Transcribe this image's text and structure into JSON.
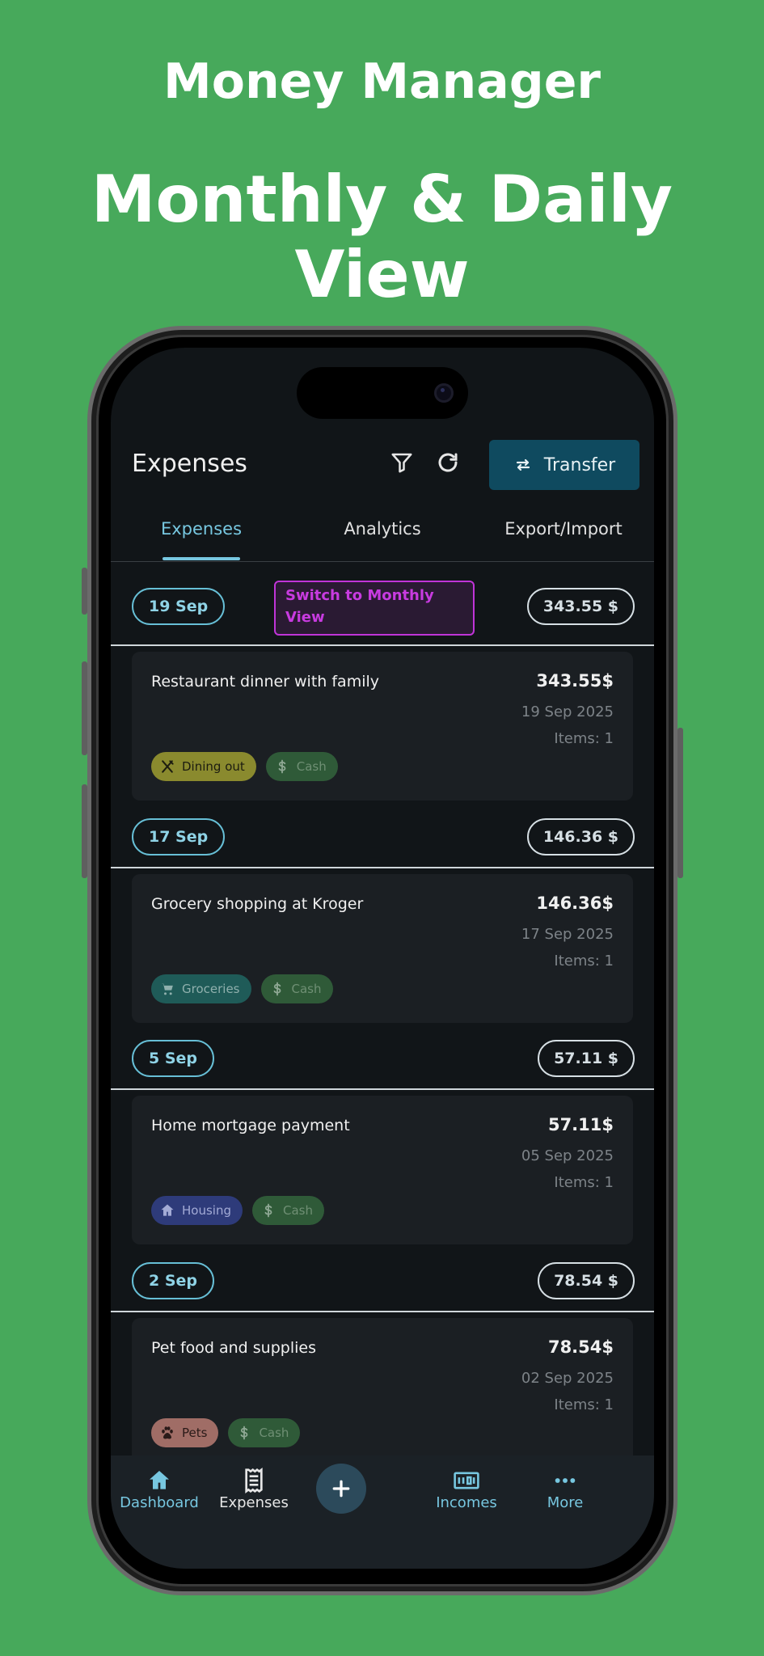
{
  "hero": {
    "app_name": "Money Manager",
    "headline": "Monthly & Daily View"
  },
  "appbar": {
    "title": "Expenses",
    "transfer_label": "Transfer"
  },
  "tabs": [
    {
      "label": "Expenses",
      "active": true
    },
    {
      "label": "Analytics",
      "active": false
    },
    {
      "label": "Export/Import",
      "active": false
    }
  ],
  "switch_view_label": "Switch to Monthly View",
  "groups": [
    {
      "day": "19 Sep",
      "total": "343.55 $",
      "expense": {
        "title": "Restaurant dinner with family",
        "amount": "343.55$",
        "date": "19 Sep 2025",
        "items": "Items: 1",
        "category": {
          "label": "Dining out",
          "icon": "utensils-icon",
          "bg": "#8a8a2e",
          "fg": "#1c1c10"
        },
        "payment": {
          "label": "Cash",
          "icon": "dollar-icon"
        }
      }
    },
    {
      "day": "17 Sep",
      "total": "146.36 $",
      "expense": {
        "title": "Grocery shopping at Kroger",
        "amount": "146.36$",
        "date": "17 Sep 2025",
        "items": "Items: 1",
        "category": {
          "label": "Groceries",
          "icon": "cart-icon",
          "bg": "#1f5b58",
          "fg": "#8fb0ad"
        },
        "payment": {
          "label": "Cash",
          "icon": "dollar-icon"
        }
      }
    },
    {
      "day": "5 Sep",
      "total": "57.11 $",
      "expense": {
        "title": "Home mortgage payment",
        "amount": "57.11$",
        "date": "05 Sep 2025",
        "items": "Items: 1",
        "category": {
          "label": "Housing",
          "icon": "home-icon",
          "bg": "#2e3b7a",
          "fg": "#a3abd6"
        },
        "payment": {
          "label": "Cash",
          "icon": "dollar-icon"
        }
      }
    },
    {
      "day": "2 Sep",
      "total": "78.54 $",
      "expense": {
        "title": "Pet food and supplies",
        "amount": "78.54$",
        "date": "02 Sep 2025",
        "items": "Items: 1",
        "category": {
          "label": "Pets",
          "icon": "paw-icon",
          "bg": "#a06d66",
          "fg": "#2a1a18"
        },
        "payment": {
          "label": "Cash",
          "icon": "dollar-icon"
        }
      }
    }
  ],
  "bottom_nav": [
    {
      "label": "Dashboard",
      "icon": "home-icon"
    },
    {
      "label": "Expenses",
      "icon": "receipt-icon"
    },
    {
      "label": "",
      "icon": "plus-icon"
    },
    {
      "label": "Incomes",
      "icon": "cash-icon"
    },
    {
      "label": "More",
      "icon": "more-icon"
    }
  ],
  "colors": {
    "background": "#47a95b",
    "accent": "#77c7e0",
    "screen_bg": "#111518",
    "switch_button": "#c034d8",
    "cash_chip": "#2f5a38"
  }
}
